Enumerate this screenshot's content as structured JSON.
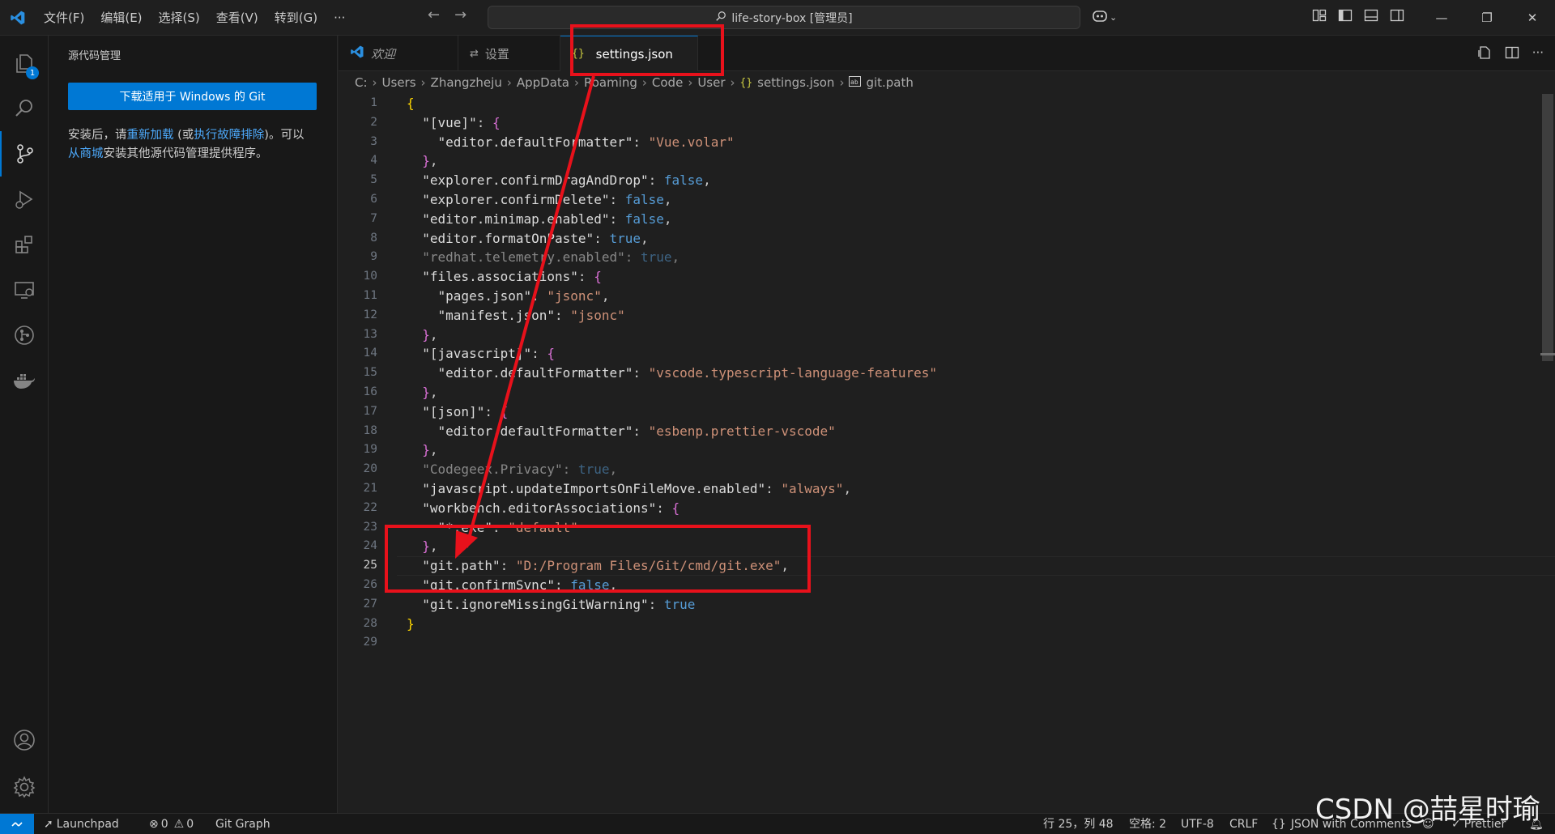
{
  "menu": [
    "文件(F)",
    "编辑(E)",
    "选择(S)",
    "查看(V)",
    "转到(G)",
    "···"
  ],
  "command_center": "life-story-box [管理员]",
  "sidebar": {
    "title": "源代码管理",
    "download_button": "下载适用于 Windows 的 Git",
    "text_1": "安装后，请",
    "link_reload": "重新加载",
    "text_2": " (或",
    "link_troubleshoot": "执行故障排除",
    "text_3": ")。可以",
    "link_marketplace": "从商城",
    "text_4": "安装其他源代码管理提供程序。"
  },
  "activity_badge": "1",
  "tabs": [
    {
      "label": "欢迎"
    },
    {
      "label": "设置"
    },
    {
      "label": "settings.json",
      "modified": true
    }
  ],
  "breadcrumb": [
    "C:",
    "Users",
    "Zhangzheju",
    "AppData",
    "Roaming",
    "Code",
    "User",
    "settings.json",
    "git.path"
  ],
  "code_lines": [
    "{",
    "  \"[vue]\": {",
    "    \"editor.defaultFormatter\": \"Vue.volar\"",
    "  },",
    "  \"explorer.confirmDragAndDrop\": false,",
    "  \"explorer.confirmDelete\": false,",
    "  \"editor.minimap.enabled\": false,",
    "  \"editor.formatOnPaste\": true,",
    "  \"redhat.telemetry.enabled\": true,",
    "  \"files.associations\": {",
    "    \"pages.json\": \"jsonc\",",
    "    \"manifest.json\": \"jsonc\"",
    "  },",
    "  \"[javascript]\": {",
    "    \"editor.defaultFormatter\": \"vscode.typescript-language-features\"",
    "  },",
    "  \"[json]\": {",
    "    \"editor.defaultFormatter\": \"esbenp.prettier-vscode\"",
    "  },",
    "  \"Codegeex.Privacy\": true,",
    "  \"javascript.updateImportsOnFileMove.enabled\": \"always\",",
    "  \"workbench.editorAssociations\": {",
    "    \"*.exe\": \"default\"",
    "  },",
    "  \"git.path\": \"D:/Program Files/Git/cmd/git.exe\",",
    "  \"git.confirmSync\": false,",
    "  \"git.ignoreMissingGitWarning\": true",
    "}",
    ""
  ],
  "current_line": 25,
  "status": {
    "launchpad": "Launchpad",
    "errors": "0",
    "warnings": "0",
    "git_graph": "Git Graph",
    "position": "行 25，列 48",
    "indent": "空格: 2",
    "encoding": "UTF-8",
    "eol": "CRLF",
    "language": "JSON with Comments",
    "prettier": "Prettier"
  },
  "watermark": "CSDN @喆星时瑜",
  "colors": {
    "accent": "#0078d4",
    "annotation": "#e8111b",
    "string": "#ce9178",
    "keyword": "#569cd6"
  }
}
